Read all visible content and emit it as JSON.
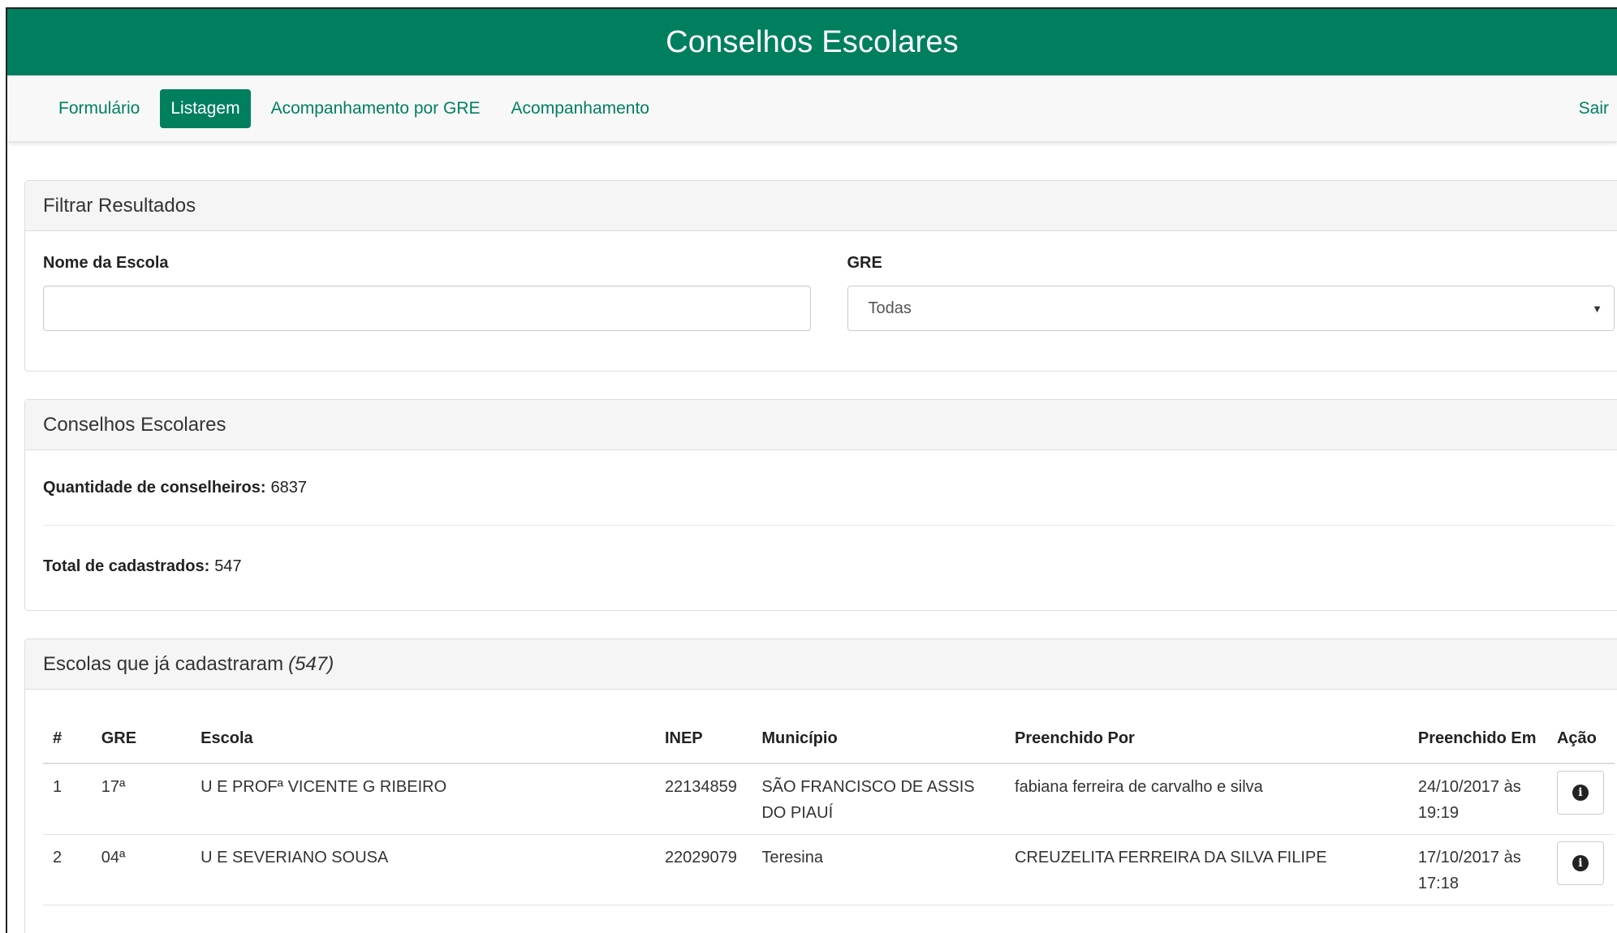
{
  "app": {
    "title": "Conselhos Escolares"
  },
  "nav": {
    "items": [
      {
        "label": "Formulário",
        "active": false
      },
      {
        "label": "Listagem",
        "active": true
      },
      {
        "label": "Acompanhamento por GRE",
        "active": false
      },
      {
        "label": "Acompanhamento",
        "active": false
      }
    ],
    "logout": "Sair"
  },
  "filter": {
    "heading": "Filtrar Resultados",
    "school_label": "Nome da Escola",
    "school_value": "",
    "gre_label": "GRE",
    "gre_selected": "Todas"
  },
  "counts": {
    "heading": "Conselhos Escolares",
    "councils_label": "Quantidade de conselheiros:",
    "councils_value": "6837",
    "registered_label": "Total de cadastrados:",
    "registered_value": "547"
  },
  "list": {
    "heading": "Escolas que já cadastraram",
    "count": "(547)",
    "columns": [
      "#",
      "GRE",
      "Escola",
      "INEP",
      "Município",
      "Preenchido Por",
      "Preenchido Em",
      "Ação"
    ],
    "rows": [
      {
        "num": "1",
        "gre": "17ª",
        "school": "U E PROFª VICENTE G RIBEIRO",
        "inep": "22134859",
        "city": "SÃO FRANCISCO DE ASSIS DO PIAUÍ",
        "filled_by": "fabiana ferreira de carvalho e silva",
        "filled_at": "24/10/2017 às 19:19"
      },
      {
        "num": "2",
        "gre": "04ª",
        "school": "U E SEVERIANO SOUSA",
        "inep": "22029079",
        "city": "Teresina",
        "filled_by": "CREUZELITA FERREIRA DA SILVA FILIPE",
        "filled_at": "17/10/2017 às 17:18"
      }
    ]
  },
  "icons": {
    "info": "info-circle-icon",
    "select_caret": "caret-down-icon"
  },
  "colors": {
    "brand": "#007f5f"
  }
}
